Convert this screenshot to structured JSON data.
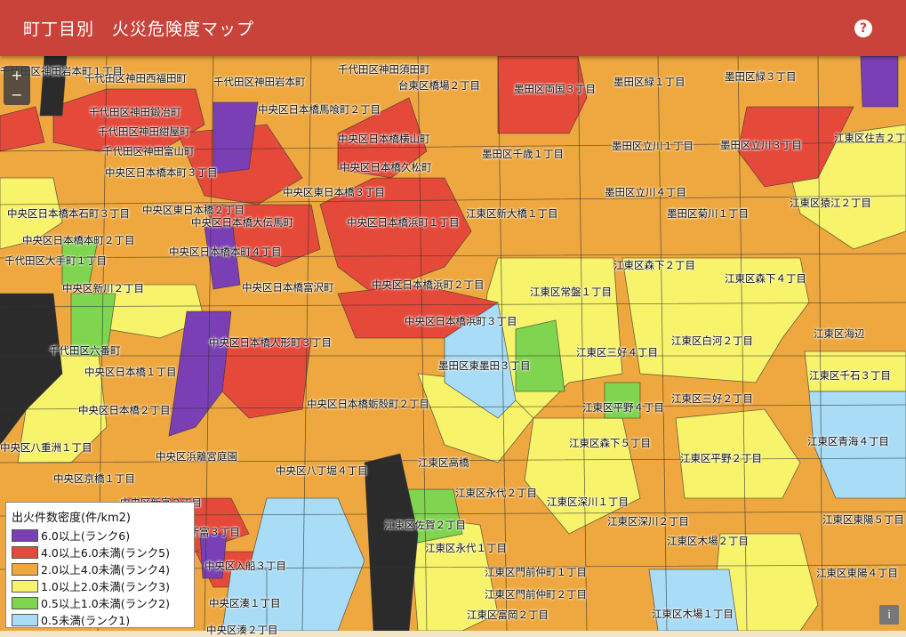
{
  "header": {
    "title": "町丁目別　火災危険度マップ",
    "help_glyph": "?"
  },
  "zoom": {
    "in": "+",
    "out": "−"
  },
  "colors": {
    "rank6": "#7b3fb5",
    "rank5": "#e5493a",
    "rank4": "#efa83f",
    "rank3": "#f7f36a",
    "rank2": "#7fd54f",
    "rank1": "#a9dcf6",
    "header": "#c9433a",
    "water": "#a9dcf6",
    "dark": "#2b2b2b"
  },
  "legend": {
    "title": "出火件数密度(件/km2)",
    "items": [
      {
        "label": "6.0以上(ランク6)",
        "color": "#7b3fb5"
      },
      {
        "label": "4.0以上6.0未満(ランク5)",
        "color": "#e5493a"
      },
      {
        "label": "2.0以上4.0未満(ランク4)",
        "color": "#efa83f"
      },
      {
        "label": "1.0以上2.0未満(ランク3)",
        "color": "#f7f36a"
      },
      {
        "label": "0.5以上1.0未満(ランク2)",
        "color": "#7fd54f"
      },
      {
        "label": "0.5未満(ランク1)",
        "color": "#a9dcf6"
      }
    ]
  },
  "info_glyph": "i",
  "labels": [
    "千代田区神田西福田町",
    "千代田区神田岩本町",
    "台東区橋場２丁目",
    "墨田区両国３丁目",
    "墨田区緑１丁目",
    "墨田区緑３丁目",
    "墨田区立川３丁目",
    "千代田区神田鍛冶町",
    "中央区日本橋馬喰町２丁目",
    "千代田区神田紺屋町",
    "中央区日本橋横山町",
    "千代田区神田富山町",
    "中央区日本橋久松町",
    "墨田区立川１丁目",
    "墨田区千歳１丁目",
    "江東区住吉２丁目",
    "中央区日本橋本町３丁目",
    "中央区東日本橋３丁目",
    "墨田区立川４丁目",
    "江東区猿江２丁目",
    "中央区日本橋本石町３丁目",
    "中央区日本橋大伝馬町",
    "中央区日本橋浜町１丁目",
    "江東区新大橋１丁目",
    "墨田区菊川１丁目",
    "中央区日本橋本町２丁目",
    "中央区日本橋本町４丁目",
    "千代田区大手町１丁目",
    "江東区森下２丁目",
    "江東区森下４丁目",
    "中央区新川２丁目",
    "中央区日本橋富沢町",
    "中央区日本橋浜町２丁目",
    "江東区常盤１丁目",
    "中央区日本橋浜町３丁目",
    "江東区海辺",
    "千代田区六番町",
    "中央区日本橋人形町３丁目",
    "江東区三好４丁目",
    "江東区白河２丁目",
    "墨田区東墨田３丁目",
    "中央区日本橋１丁目",
    "江東区千石３丁目",
    "江東区三好２丁目",
    "中央区日本橋２丁目",
    "中央区日本橋蛎殻町２丁目",
    "江東区平野４丁目",
    "江東区森下５丁目",
    "江東区青海４丁目",
    "中央区八重洲１丁目",
    "中央区浜離宮庭園",
    "江東区高橋",
    "江東区平野２丁目",
    "中央区八丁堀４丁目",
    "中央区京橋１丁目",
    "江東区永代２丁目",
    "中央区新富２丁目",
    "江東区深川１丁目",
    "江東区佐賀２丁目",
    "江東区深川２丁目",
    "江東区東陽５丁目",
    "中央区新富３丁目",
    "江東区永代１丁目",
    "江東区木場２丁目",
    "中央区入船３丁目",
    "江東区門前仲町１丁目",
    "江東区東陽４丁目",
    "江東区門前仲町２丁目",
    "中央区湊１丁目",
    "江東区富岡２丁目",
    "江東区木場１丁目",
    "中央区湊２丁目",
    "千代田区神田岩本町１丁目",
    "中央区東日本橋２丁目",
    "千代田区神田須田町",
    "墨田区東駒形"
  ]
}
